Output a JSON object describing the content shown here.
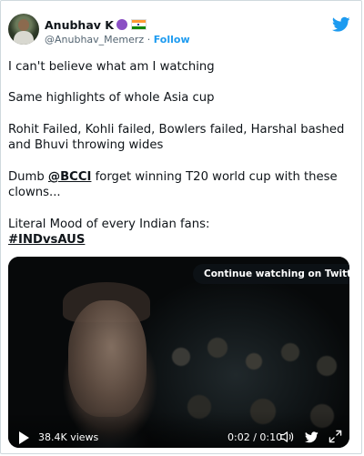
{
  "author": {
    "name": "Anubhav K",
    "handle": "@Anubhav_Memerz",
    "separator": "·",
    "follow_label": "Follow",
    "emoji_icon": "smiling-devil-icon",
    "flag_icon": "india-flag-icon"
  },
  "tweet": {
    "lines": [
      "I can't believe what am I watching",
      "Same highlights of whole Asia cup",
      "Rohit Failed, Kohli failed, Bowlers failed, Harshal bashed",
      "and Bhuvi throwing wides",
      "clowns...",
      "Literal Mood of every Indian fans:"
    ],
    "dumb_prefix": "Dumb ",
    "mention": "@BCCI",
    "dumb_suffix": " forget winning T20 world cup with these",
    "hashtag": "#INDvsAUS"
  },
  "video": {
    "continue_label": "Continue watching on Twitter",
    "views": "38.4K views",
    "time": "0:02 / 0:10"
  },
  "colors": {
    "accent": "#1d9bf0",
    "text": "#0f1419",
    "secondary": "#536471"
  }
}
